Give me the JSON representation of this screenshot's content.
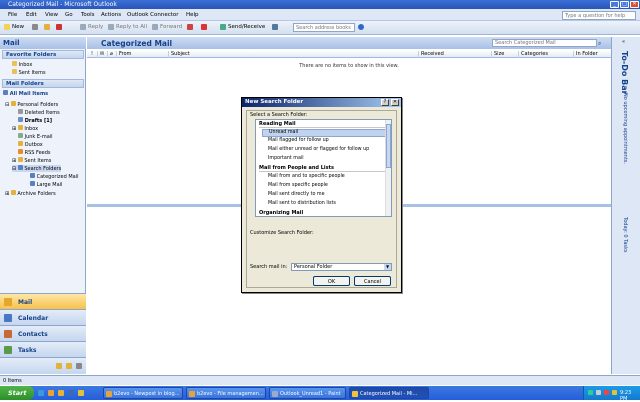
{
  "window": {
    "title": "Categorized Mail - Microsoft Outlook",
    "controls": [
      "_",
      "□",
      "✕"
    ]
  },
  "menu": {
    "items": [
      "File",
      "Edit",
      "View",
      "Go",
      "Tools",
      "Actions",
      "Outlook Connector",
      "Help"
    ],
    "help_placeholder": "Type a question for help"
  },
  "toolbar": {
    "new": "New",
    "reply": "Reply",
    "reply_all": "Reply to All",
    "forward": "Forward",
    "send_receive": "Send/Receive",
    "search_placeholder": "Search address books"
  },
  "nav": {
    "title": "Mail",
    "favorites_header": "Favorite Folders",
    "favorites": [
      "Inbox",
      "Sent Items"
    ],
    "mail_folders_header": "Mail Folders",
    "all_mail_items": "All Mail Items",
    "tree": [
      {
        "label": "Personal Folders",
        "indent": 0
      },
      {
        "label": "Deleted Items",
        "indent": 1
      },
      {
        "label": "Drafts [1]",
        "indent": 1,
        "bold": true
      },
      {
        "label": "Inbox",
        "indent": 1
      },
      {
        "label": "Junk E-mail",
        "indent": 1
      },
      {
        "label": "Outbox",
        "indent": 1
      },
      {
        "label": "RSS Feeds",
        "indent": 1
      },
      {
        "label": "Sent Items",
        "indent": 1
      },
      {
        "label": "Search Folders",
        "indent": 1,
        "selected": true
      },
      {
        "label": "Categorized Mail",
        "indent": 2
      },
      {
        "label": "Large Mail",
        "indent": 2
      },
      {
        "label": "Archive Folders",
        "indent": 0
      }
    ],
    "buttons": [
      {
        "label": "Mail",
        "active": true
      },
      {
        "label": "Calendar"
      },
      {
        "label": "Contacts"
      },
      {
        "label": "Tasks"
      }
    ]
  },
  "main": {
    "title": "Categorized Mail",
    "search_placeholder": "Search Categorized Mail",
    "columns": [
      "From",
      "Subject",
      "Received",
      "Size",
      "Categories",
      "In Folder"
    ],
    "empty_message": "There are no items to show in this view."
  },
  "todo": {
    "title": "To-Do Bar",
    "appointments": "No upcoming appointments.",
    "tasks": "Today: 0 Tasks"
  },
  "status": {
    "text": "0 Items"
  },
  "taskbar": {
    "start": "Start",
    "tasks": [
      "b2evo - Newpost in blog...",
      "b2evo - File managemen...",
      "Outlook_Unread1 - Paint",
      "Categorized Mail - Mi..."
    ],
    "clock": "9:23 PM"
  },
  "dialog": {
    "title": "New Search Folder",
    "select_label": "Select a Search Folder:",
    "groups": [
      {
        "name": "Reading Mail",
        "items": [
          "Unread mail",
          "Mail flagged for follow up",
          "Mail either unread or flagged for follow up",
          "Important mail"
        ]
      },
      {
        "name": "Mail from People and Lists",
        "items": [
          "Mail from and to specific people",
          "Mail from specific people",
          "Mail sent directly to me",
          "Mail sent to distribution lists"
        ]
      },
      {
        "name": "Organizing Mail",
        "items": []
      }
    ],
    "selected_item": "Unread mail",
    "customize_label": "Customize Search Folder:",
    "search_in_label": "Search mail in:",
    "search_in_value": "Personal Folder",
    "ok": "OK",
    "cancel": "Cancel"
  }
}
